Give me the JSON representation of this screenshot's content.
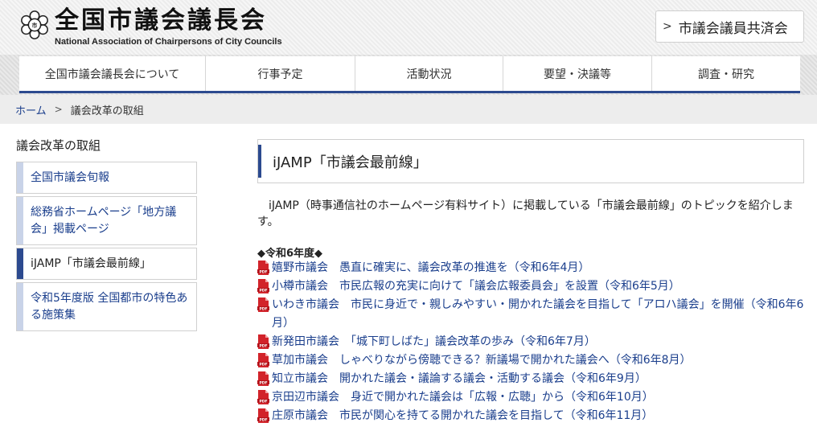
{
  "header": {
    "title": "全国市議会議長会",
    "subtitle": "National Association of Chairpersons of City Councils",
    "mutual_aid_button": "市議会議員共済会"
  },
  "nav": {
    "items": [
      {
        "label": "全国市議会議長会について"
      },
      {
        "label": "行事予定"
      },
      {
        "label": "活動状況"
      },
      {
        "label": "要望・決議等"
      },
      {
        "label": "調査・研究"
      }
    ]
  },
  "breadcrumb": {
    "home": "ホーム",
    "current": "議会改革の取組"
  },
  "sidebar": {
    "title": "議会改革の取組",
    "items": [
      {
        "label": "全国市議会旬報",
        "active": false
      },
      {
        "label": "総務省ホームページ「地方議会」掲載ページ",
        "active": false
      },
      {
        "label": "iJAMP「市議会最前線」",
        "active": true
      },
      {
        "label": "令和5年度版 全国都市の特色ある施策集",
        "active": false
      }
    ]
  },
  "main": {
    "heading": "iJAMP「市議会最前線」",
    "intro": "iJAMP（時事通信社のホームページ有料サイト）に掲載している「市議会最前線」のトピックを紹介します。",
    "year_heading": "◆令和6年度◆",
    "topics": [
      {
        "text": "嬉野市議会　愚直に確実に、議会改革の推進を（令和6年4月）"
      },
      {
        "text": "小樽市議会　市民広報の充実に向けて「議会広報委員会」を設置（令和6年5月）"
      },
      {
        "text": "いわき市議会　市民に身近で・親しみやすい・開かれた議会を目指して「アロハ議会」を開催（令和6年6月）"
      },
      {
        "text": "新発田市議会　「城下町しばた」議会改革の歩み（令和6年7月）"
      },
      {
        "text": "草加市議会　しゃべりながら傍聴できる？新議場で開かれた議会へ（令和6年8月）"
      },
      {
        "text": "知立市議会　開かれた議会・議論する議会・活動する議会（令和6年9月）"
      },
      {
        "text": "京田辺市議会　身近で開かれた議会は「広報・広聴」から（令和6年10月）"
      },
      {
        "text": "庄原市議会　市民が関心を持てる開かれた議会を目指して（令和6年11月）"
      }
    ]
  },
  "icons": {
    "logo": "emblem-icon",
    "topic": "pdf-icon",
    "chevron": "chevron-right-icon"
  },
  "colors": {
    "accent": "#2c4a8f",
    "link": "#1a3e8c",
    "pdf_red": "#d2232a"
  }
}
